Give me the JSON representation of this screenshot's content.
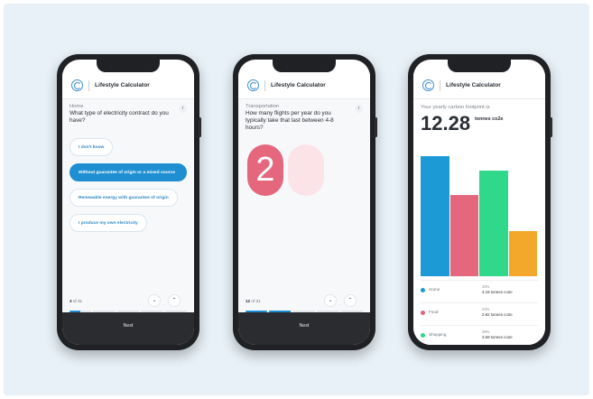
{
  "app": {
    "title": "Lifestyle Calculator",
    "logo_icon": "un-logo-icon",
    "info_icon": "info-icon"
  },
  "screen1": {
    "category": "Home",
    "question": "What type of electricity contract do you have?",
    "options": [
      {
        "label": "I don't know",
        "selected": false
      },
      {
        "label": "Without guarantee of origin or a mixed source",
        "selected": true
      },
      {
        "label": "Renewable energy with guarantee of origin",
        "selected": false
      },
      {
        "label": "I produce my own electricity",
        "selected": false
      }
    ],
    "pager": {
      "current": "3",
      "rest": " of 31"
    },
    "progress": 0.1,
    "next_label": "Next"
  },
  "screen2": {
    "category": "Transportation",
    "question": "How many flights per year do you typically take that last between 4-8 hours?",
    "digits": [
      "2",
      ""
    ],
    "pager": {
      "current": "12",
      "rest": " of 31"
    },
    "progress": 0.39,
    "next_label": "Next"
  },
  "screen3": {
    "label": "Your yearly carbon footprint is",
    "value": "12.28",
    "unit": "tonnes co2e",
    "chart_data": {
      "type": "bar",
      "categories": [
        "Home",
        "Food",
        "Shopping",
        ""
      ],
      "values": [
        4.19,
        2.82,
        3.69,
        1.58
      ],
      "colors": [
        "#1b9ad6",
        "#e4677d",
        "#2fd88a",
        "#f4a82b"
      ],
      "ylim": [
        0,
        4.4
      ]
    },
    "legend": [
      {
        "name": "Home",
        "pct": "33%",
        "val": "4.19 tonnes co2e",
        "color": "#1b9ad6"
      },
      {
        "name": "Food",
        "pct": "24%",
        "val": "2.82 tonnes co2e",
        "color": "#e4677d"
      },
      {
        "name": "Shopping",
        "pct": "29%",
        "val": "3.69 tonnes co2e",
        "color": "#2fd88a"
      }
    ]
  },
  "colors": {
    "accent": "#1f8fd2",
    "footer": "#2a2c30",
    "digit_active": "#e4677d",
    "digit_inactive": "#fbe3e7"
  }
}
